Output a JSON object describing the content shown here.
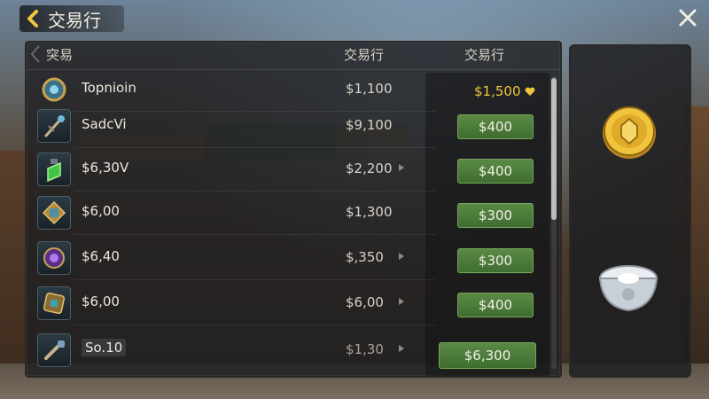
{
  "header": {
    "title": "交易行"
  },
  "table": {
    "headers": [
      "突易",
      "交易行",
      "交易行"
    ],
    "rows": [
      {
        "name": "Topnioin",
        "price": "$1,100",
        "action": "$1,500",
        "icon": "amulet-icon"
      },
      {
        "name": "SadcVi",
        "price": "$9,100",
        "action": "$400",
        "icon": "staff-icon"
      },
      {
        "name": "$6,30V",
        "price": "$2,200",
        "action": "$400",
        "icon": "potion-icon"
      },
      {
        "name": "$6,00",
        "price": "$1,300",
        "action": "$300",
        "icon": "gem-box-icon"
      },
      {
        "name": "$6,40",
        "price": "$,350",
        "action": "$300",
        "icon": "orb-icon"
      },
      {
        "name": "$6,00",
        "price": "$6,00",
        "action": "$400",
        "icon": "rune-box-icon"
      },
      {
        "name": "So.10",
        "price": "$1,30",
        "action": "$6,300",
        "icon": "key-icon"
      }
    ]
  },
  "colors": {
    "gold": "#f2c63c",
    "button_green": "#4f7d3c"
  },
  "side_panel": {
    "icons": [
      "gold-coin-icon",
      "silver-bowl-icon"
    ]
  }
}
